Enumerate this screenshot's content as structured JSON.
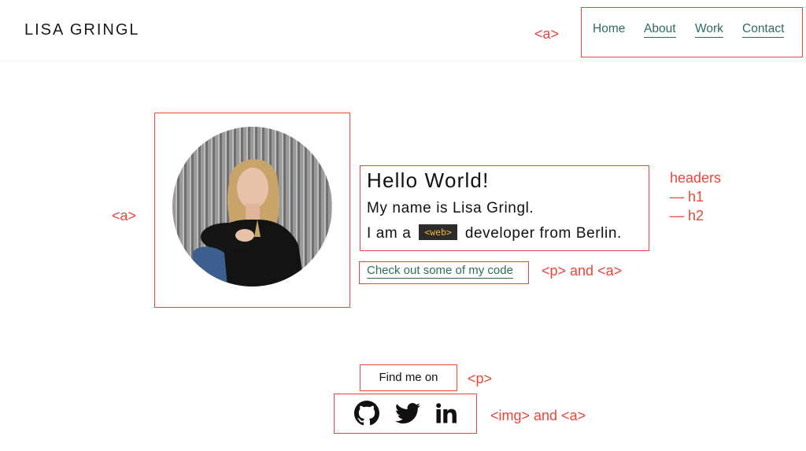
{
  "header": {
    "logo": "LISA GRINGL",
    "nav": [
      {
        "label": "Home"
      },
      {
        "label": "About"
      },
      {
        "label": "Work"
      },
      {
        "label": "Contact"
      }
    ]
  },
  "hero": {
    "h1": "Hello World!",
    "h2_name": "My name is Lisa Gringl.",
    "h2_prefix": "I am a",
    "badge": "<web>",
    "h2_suffix": "developer from Berlin.",
    "code_link": "Check out some of my code"
  },
  "social": {
    "label": "Find me on",
    "icons": [
      "github-icon",
      "twitter-icon",
      "linkedin-icon"
    ]
  },
  "annotations": {
    "nav_a": "<a>",
    "avatar_a": "<a>",
    "headers_title": "headers",
    "headers_h1": "— h1",
    "headers_h2": "— h2",
    "p_and_a": "<p> and <a>",
    "p": "<p>",
    "img_and_a": "<img> and <a>"
  },
  "colors": {
    "annotation": "#e8463c",
    "link": "#2e6b5e",
    "badge_bg": "#2b2b2b",
    "badge_text": "#f2b63c"
  }
}
